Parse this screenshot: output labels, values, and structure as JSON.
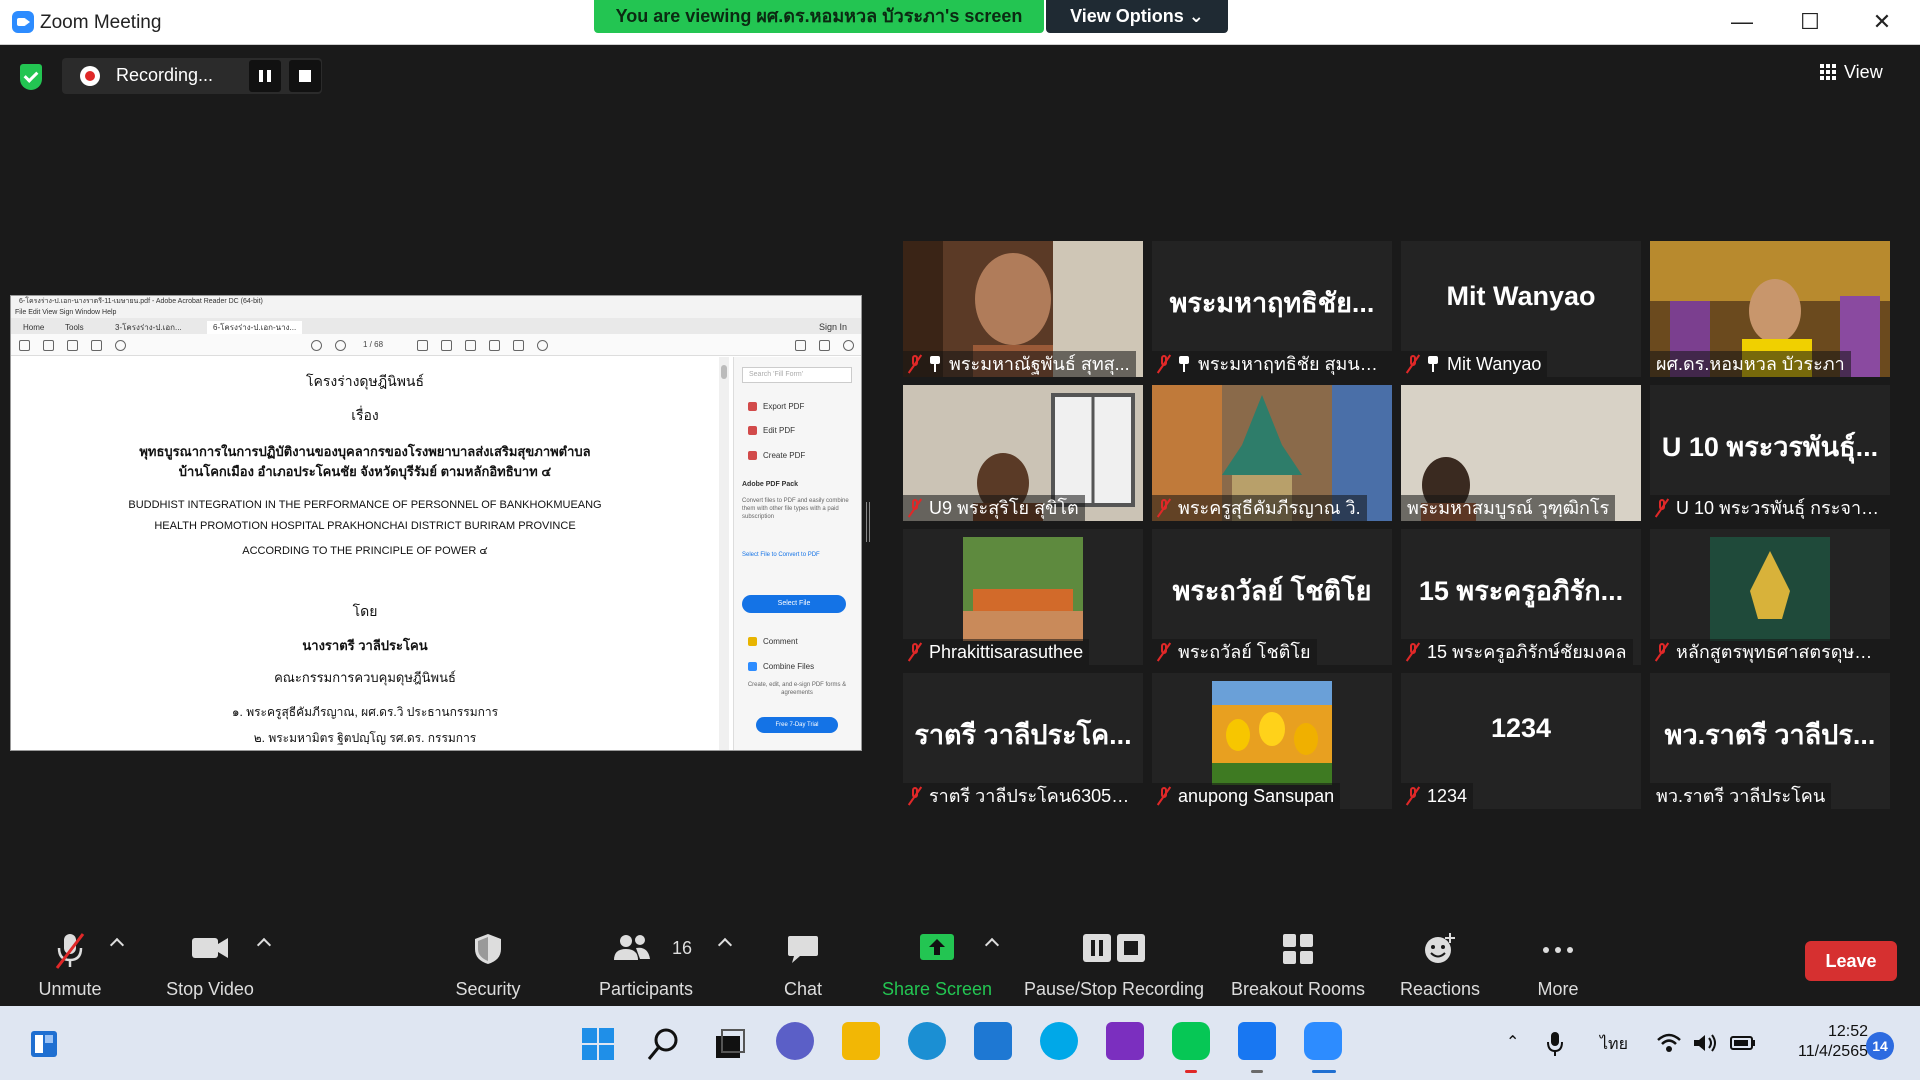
{
  "window": {
    "title": "Zoom Meeting",
    "viewing_banner": "You are viewing ผศ.ดร.หอมหวล บัวระภา's screen",
    "view_options": "View Options ⌄",
    "minimize": "—",
    "maximize": "☐",
    "close": "✕"
  },
  "topbar": {
    "recording": "Recording...",
    "view": "View"
  },
  "shared_screen": {
    "app_title": "6-โครงร่าง-ป.เอก-นางราตรี-11-เมษายน.pdf - Adobe Acrobat Reader DC (64-bit)",
    "menu": "File   Edit   View   Sign   Window   Help",
    "tabs": [
      "Home",
      "Tools",
      "3-โครงร่าง-ป.เอก...",
      "6-โครงร่าง-ป.เอก-นาง..."
    ],
    "sign_in": "Sign In",
    "page_indicator": "1 / 68",
    "pdf_lines": [
      "โครงร่างดุษฎีนิพนธ์",
      "เรื่อง",
      "พุทธบูรณาการในการปฏิบัติงานของบุคลากรของโรงพยาบาลส่งเสริมสุขภาพตำบล",
      "บ้านโคกเมือง อำเภอประโคนชัย จังหวัดบุรีรัมย์ ตามหลักอิทธิบาท ๔",
      "BUDDHIST INTEGRATION IN THE PERFORMANCE OF PERSONNEL OF BANKHOKMUEANG",
      "HEALTH PROMOTION HOSPITAL PRAKHONCHAI DISTRICT BURIRAM PROVINCE",
      "ACCORDING TO THE PRINCIPLE OF POWER ๔",
      "โดย",
      "นางราตรี วาลีประโคน",
      "คณะกรรมการควบคุมดุษฎีนิพนธ์",
      "๑. พระครูสุธีคัมภีรญาณ, ผศ.ดร.วิ ประธานกรรมการ",
      "๒. พระมหามิตร ฐิตปญฺโญ รศ.ดร. กรรมการ"
    ],
    "side_panel": {
      "search": "Search 'Fill Form'",
      "export": "Export PDF",
      "edit": "Edit PDF",
      "create": "Create PDF",
      "pack_title": "Adobe PDF Pack",
      "pack_desc": "Convert files to PDF and easily combine them with other file types with a paid subscription",
      "select_label": "Select File to Convert to PDF",
      "select_btn": "Select File",
      "comment": "Comment",
      "combine": "Combine Files",
      "promo": "Create, edit, and e-sign PDF forms & agreements",
      "trial": "Free 7-Day Trial"
    }
  },
  "participants": [
    {
      "label": "พระมหาณัฐพันธ์ สุทสุ...",
      "big": "",
      "muted": true,
      "pinned": true,
      "video": "person1"
    },
    {
      "label": "พระมหาฤทธิชัย สุมนต...",
      "big": "พระมหาฤทธิชัย...",
      "muted": true,
      "pinned": true,
      "video": ""
    },
    {
      "label": "Mit Wanyao",
      "big": "Mit Wanyao",
      "muted": true,
      "pinned": true,
      "video": ""
    },
    {
      "label": "ผศ.ดร.หอมหวล บัวระภา",
      "big": "",
      "muted": false,
      "pinned": false,
      "video": "temple",
      "active": true
    },
    {
      "label": "U9 พระสุริโย สุขิโต",
      "big": "",
      "muted": true,
      "pinned": false,
      "video": "room"
    },
    {
      "label": "พระครูสุธีคัมภีรญาณ วิ.",
      "big": "",
      "muted": true,
      "pinned": false,
      "video": "shrine"
    },
    {
      "label": "พระมหาสมบูรณ์ วุฑฺฒิกโร",
      "big": "",
      "muted": false,
      "pinned": false,
      "video": "wall"
    },
    {
      "label": "U 10 พระวรพันธุ์ กระจาย...",
      "big": "U 10 พระวรพันธุ์...",
      "muted": true,
      "pinned": false,
      "video": ""
    },
    {
      "label": "Phrakittisarasuthee",
      "big": "",
      "muted": true,
      "pinned": false,
      "video": "sign"
    },
    {
      "label": "พระถวัลย์ โชติโย",
      "big": "พระถวัลย์ โชติโย",
      "muted": true,
      "pinned": false,
      "video": ""
    },
    {
      "label": "15 พระครูอภิรักษ์ชัยมงคล",
      "big": "15 พระครูอภิรัก...",
      "muted": true,
      "pinned": false,
      "video": ""
    },
    {
      "label": "หลักสูตรพุทธศาสตรดุษฎีบั...",
      "big": "",
      "muted": true,
      "pinned": false,
      "video": "emblem"
    },
    {
      "label": "ราตรี วาลีประโคน630510...",
      "big": "ราตรี วาลีประโค...",
      "muted": true,
      "pinned": false,
      "video": ""
    },
    {
      "label": "anupong Sansupan",
      "big": "",
      "muted": true,
      "pinned": false,
      "video": "tulips"
    },
    {
      "label": "1234",
      "big": "1234",
      "muted": true,
      "pinned": false,
      "video": ""
    },
    {
      "label": "พว.ราตรี วาลีประโคน",
      "big": "พว.ราตรี วาลีปร...",
      "muted": false,
      "pinned": false,
      "video": ""
    }
  ],
  "toolbar": {
    "unmute": "Unmute",
    "stop_video": "Stop Video",
    "security": "Security",
    "participants": "Participants",
    "participants_count": "16",
    "chat": "Chat",
    "share_screen": "Share Screen",
    "pause_stop_recording": "Pause/Stop Recording",
    "breakout_rooms": "Breakout Rooms",
    "reactions": "Reactions",
    "more": "More",
    "leave": "Leave"
  },
  "taskbar": {
    "language": "ไทย",
    "time": "12:52",
    "date": "11/4/2565",
    "notifications": "14"
  },
  "colors": {
    "accent_green": "#23c552",
    "leave_red": "#d63030",
    "zoom_blue": "#2d8cff",
    "active_speaker": "#e6e62e"
  }
}
